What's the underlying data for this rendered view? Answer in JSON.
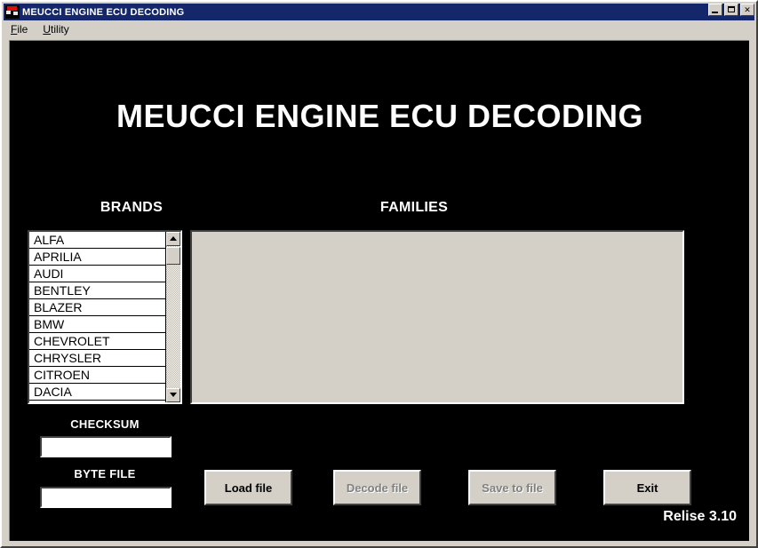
{
  "window": {
    "title": "MEUCCI ENGINE ECU DECODING",
    "icon": "app-icon",
    "controls": {
      "minimize": "minimize-icon",
      "maximize": "maximize-icon",
      "close": "close-icon",
      "close_glyph": "✕"
    },
    "colors": {
      "titlebar": "#15276b",
      "face": "#d4d0c8",
      "client": "#000000",
      "text_light": "#ffffff",
      "disabled_text": "#808080"
    }
  },
  "menu": {
    "items": [
      {
        "accesskey": "F",
        "rest": "ile"
      },
      {
        "accesskey": "U",
        "rest": "tility"
      }
    ]
  },
  "main": {
    "heading": "MEUCCI ENGINE ECU DECODING",
    "brands_label": "BRANDS",
    "families_label": "FAMILIES",
    "release": "Relise 3.10"
  },
  "brands": {
    "items": [
      "ALFA",
      "APRILIA",
      "AUDI",
      "BENTLEY",
      "BLAZER",
      "BMW",
      "CHEVROLET",
      "CHRYSLER",
      "CITROEN",
      "DACIA"
    ],
    "scrollbar": {
      "up_icon": "scroll-up-arrow-icon",
      "down_icon": "scroll-down-arrow-icon"
    }
  },
  "families": {
    "items": []
  },
  "fields": {
    "checksum": {
      "label": "CHECKSUM",
      "value": "",
      "placeholder": ""
    },
    "byte_file": {
      "label": "BYTE   FILE",
      "value": "",
      "placeholder": ""
    }
  },
  "buttons": {
    "load": {
      "label": "Load file",
      "disabled": false
    },
    "decode": {
      "label": "Decode file",
      "disabled": true
    },
    "save": {
      "label": "Save to file",
      "disabled": true
    },
    "exit": {
      "label": "Exit",
      "disabled": false
    }
  }
}
